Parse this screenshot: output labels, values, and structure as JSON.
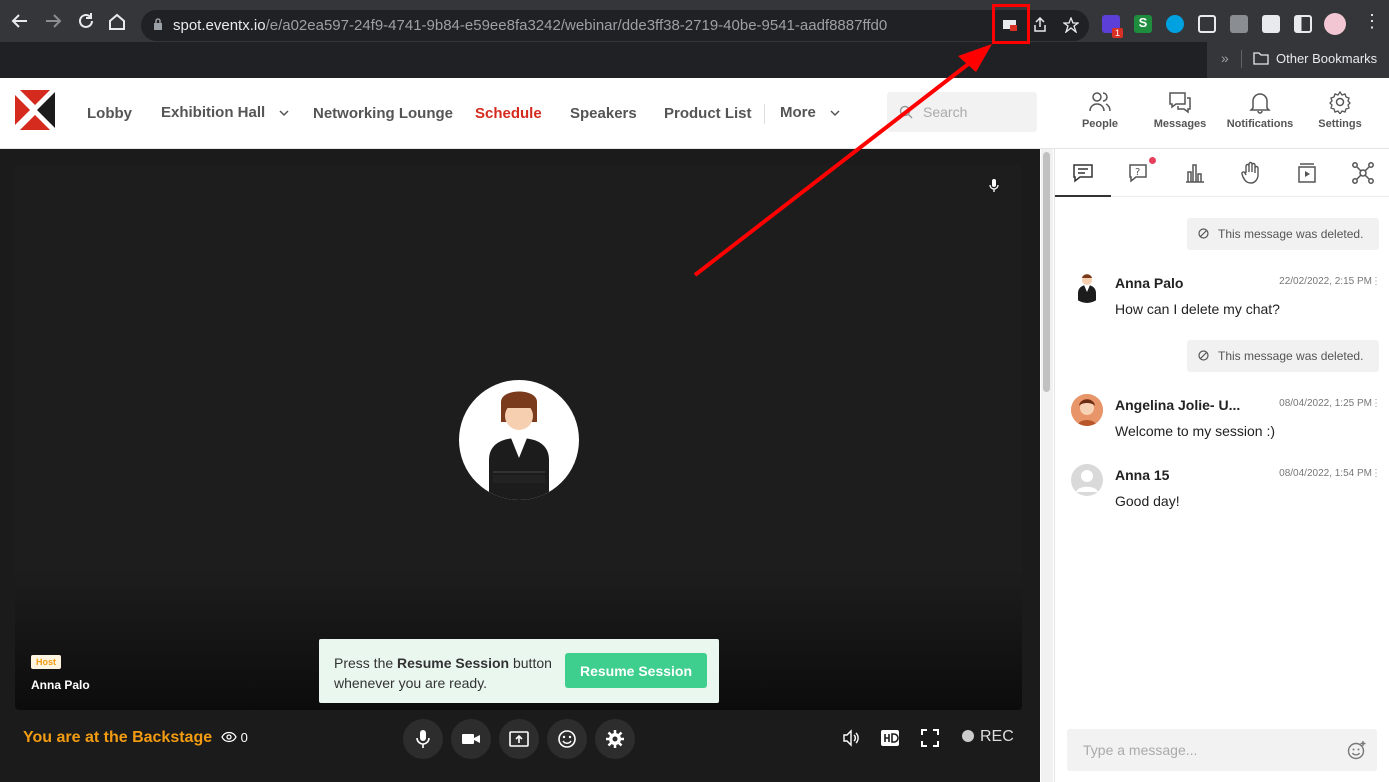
{
  "browser": {
    "url_host": "spot.eventx.io",
    "url_path": "/e/a02ea597-24f9-4741-9b84-e59ee8fa3242/webinar/dde3ff38-2719-40be-9541-aadf8887ffd0",
    "bookmarks_label": "Other Bookmarks",
    "extension_badge": "1"
  },
  "nav": {
    "items": [
      "Lobby",
      "Exhibition Hall",
      "Networking Lounge",
      "Schedule",
      "Speakers",
      "Product List",
      "More"
    ],
    "active": "Schedule",
    "search_placeholder": "Search",
    "icons": [
      {
        "label": "People",
        "icon": "people-icon"
      },
      {
        "label": "Messages",
        "icon": "messages-icon"
      },
      {
        "label": "Notifications",
        "icon": "bell-icon"
      },
      {
        "label": "Settings",
        "icon": "gear-icon"
      }
    ]
  },
  "stage": {
    "host_badge": "Host",
    "host_name": "Anna Palo",
    "toast_text_1": "Press the ",
    "toast_bold": "Resume Session",
    "toast_text_2": " button whenever you are ready.",
    "resume_button": "Resume Session",
    "status_text": "You are at the Backstage",
    "viewer_count": "0",
    "rec_label": "REC"
  },
  "chat": {
    "tabs": [
      "chat-icon",
      "qa-icon",
      "poll-icon",
      "raise-hand-icon",
      "media-icon",
      "network-icon"
    ],
    "deleted_text": "This message was deleted.",
    "messages": [
      {
        "name": "Anna Palo",
        "time": "22/02/2022, 2:15 PM",
        "text": "How can I delete my chat?"
      },
      {
        "name": "Angelina Jolie- U...",
        "time": "08/04/2022, 1:25 PM",
        "text": "Welcome to my session :)"
      },
      {
        "name": "Anna 15",
        "time": "08/04/2022, 1:54 PM",
        "text": "Good day!"
      }
    ],
    "input_placeholder": "Type a message..."
  },
  "colors": {
    "accent": "#d52b1e",
    "backstage": "#f39c12",
    "resume": "#3ecf8e",
    "annotation": "#ff0000"
  }
}
